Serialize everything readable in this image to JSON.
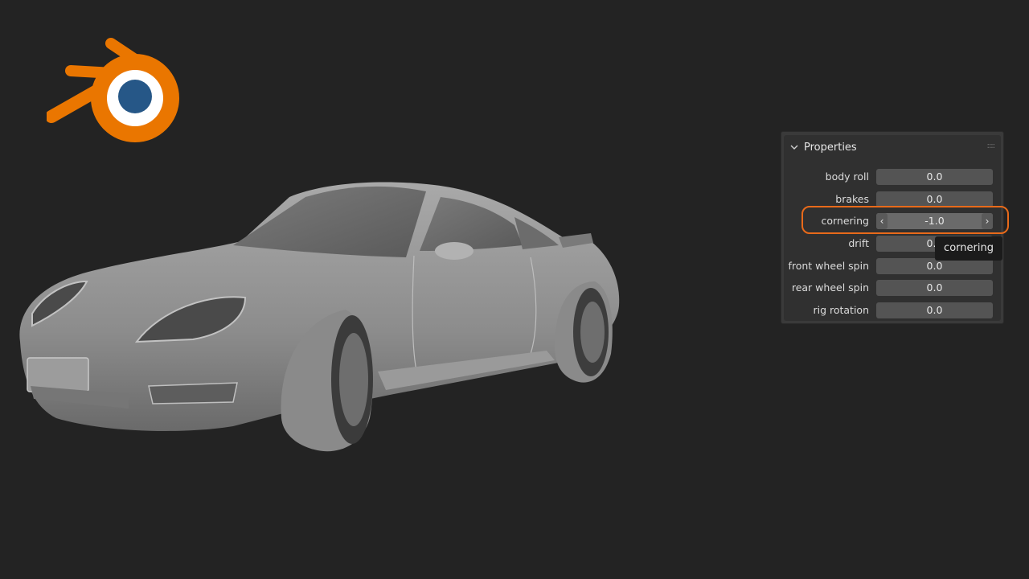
{
  "logo": {
    "name": "blender-logo-icon",
    "colors": {
      "orange": "#ea7600",
      "blue": "#265787",
      "white": "#ffffff"
    }
  },
  "viewport": {
    "object": "car-model"
  },
  "panel": {
    "title": "Properties",
    "grip_glyph": "::::",
    "properties": [
      {
        "label": "body roll",
        "value": "0.0"
      },
      {
        "label": "brakes",
        "value": "0.0"
      },
      {
        "label": "cornering",
        "value": "-1.0",
        "active": true
      },
      {
        "label": "drift",
        "value": "0.0"
      },
      {
        "label": "front wheel spin",
        "value": "0.0"
      },
      {
        "label": "rear wheel spin",
        "value": "0.0"
      },
      {
        "label": "rig rotation",
        "value": "0.0"
      }
    ],
    "arrow_left": "‹",
    "arrow_right": "›"
  },
  "tooltip": {
    "text": "cornering"
  },
  "accent": "#e86a1a"
}
